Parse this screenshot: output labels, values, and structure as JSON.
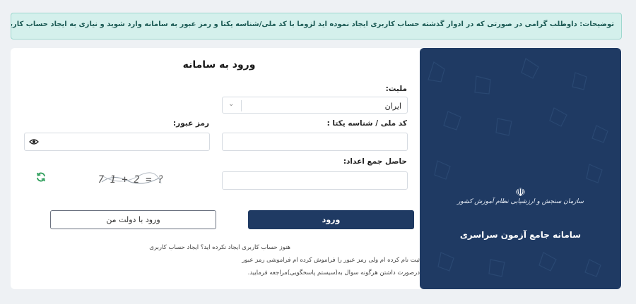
{
  "notice": {
    "text": "توضیحات: داوطلب گرامی در صورتی که در ادوار گذشته حساب کاربری ایجاد نموده اید لزوما با کد ملی/شناسه یکتا و رمز عبور به سامانه وارد شوید و نیازی به ایجاد حساب کاربری مجدد نمی‌باشد."
  },
  "brand": {
    "emblem": "☫",
    "org": "سازمان سنجش و ارزشیابی نظام آموزش کشور",
    "title": "سامانه جامع آزمون سراسری"
  },
  "form": {
    "title": "ورود به سامانه",
    "nationality_label": "ملیت:",
    "nationality_value": "ایران",
    "national_id_label": "کد ملی / شناسه یکتا :",
    "password_label": "رمز عبور:",
    "captcha_label": "حاصل جمع اعداد:",
    "captcha_text": "7 1 + 2 = ?",
    "login_button": "ورود",
    "gov_button": "ورود با دولت من"
  },
  "help": {
    "line1_text": "هنوز حساب کاربری ایجاد نکرده اید؟",
    "line1_link": "ایجاد حساب کاربری",
    "line2_text": "ثبت نام کرده ام ولی رمز عبور را فراموش کرده ام",
    "line2_link": "فراموشی رمز عبور",
    "line3": "درصورت داشتن هرگونه سوال به(سیستم پاسخگویی)مراجعه فرمایید."
  },
  "colors": {
    "primary": "#1f3a63",
    "notice_bg": "#d4f0ec",
    "refresh": "#2e9e5b"
  }
}
